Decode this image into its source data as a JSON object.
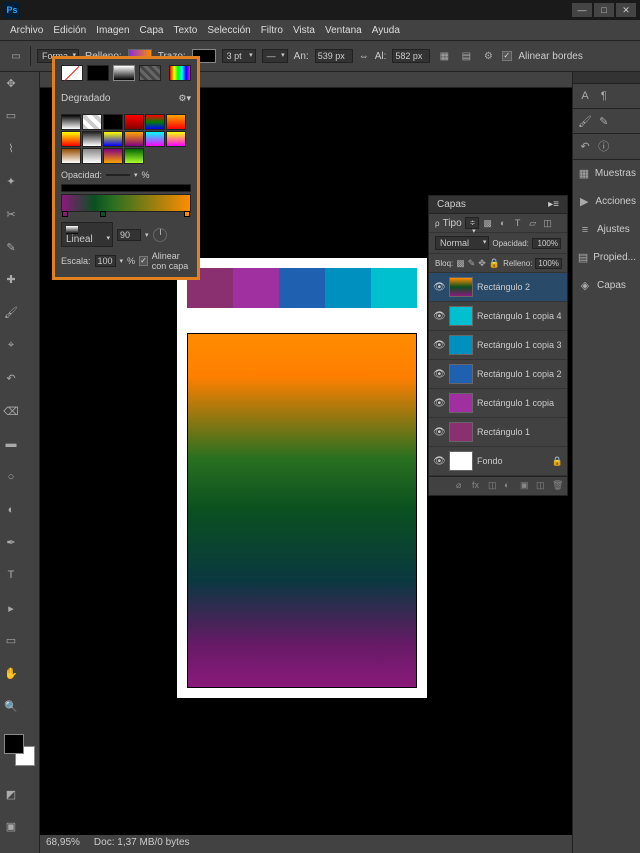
{
  "titlebar": {
    "min": "—",
    "max": "□",
    "close": "✕"
  },
  "menu": [
    "Archivo",
    "Edición",
    "Imagen",
    "Capa",
    "Texto",
    "Selección",
    "Filtro",
    "Vista",
    "Ventana",
    "Ayuda"
  ],
  "options": {
    "forma": "Forma",
    "relleno": "Relleno:",
    "trazo": "Trazo:",
    "stroke_pt": "3 pt",
    "an_lbl": "An:",
    "an": "539 px",
    "al_lbl": "Al:",
    "al": "582 px",
    "align": "Alinear bordes"
  },
  "gradPanel": {
    "title": "Degradado",
    "opacidad": "Opacidad:",
    "opac_val": "",
    "pct": "%",
    "estilo": "Lineal",
    "ang": "90",
    "ang_deg": "°",
    "escala_lbl": "Escala:",
    "escala": "100",
    "alinear": "Alinear con capa"
  },
  "presets": [
    "linear-gradient(#000,#fff)",
    "repeating-linear-gradient(45deg,#ccc 0 4px,#fff 4px 8px)",
    "linear-gradient(#000,#000)",
    "linear-gradient(red,#800)",
    "linear-gradient(red,green,blue)",
    "linear-gradient(orange,red)",
    "linear-gradient(yellow,red)",
    "linear-gradient(#222,#fff)",
    "linear-gradient(yellow,blue)",
    "linear-gradient(orange,purple)",
    "linear-gradient(cyan,magenta)",
    "linear-gradient(#ff0,#f0f)",
    "linear-gradient(#964B00,#fff)",
    "linear-gradient(#888,#fff)",
    "linear-gradient(#800080,#ffa500)",
    "linear-gradient(#006400,#adff2f)"
  ],
  "palette": [
    "#8a3070",
    "#a030a0",
    "#2060b0",
    "#0090c0",
    "#00c0d0"
  ],
  "layersPanel": {
    "tab": "Capas",
    "tipo": "Tipo",
    "blend": "Normal",
    "opac_lbl": "Opacidad:",
    "opac": "100%",
    "bloq": "Bloq:",
    "relleno_lbl": "Relleno:",
    "relleno": "100%",
    "layers": [
      {
        "name": "Rectángulo 2",
        "thumb": "linear-gradient(#ff8c00,#0a5020,#8a1a7a)",
        "sel": true
      },
      {
        "name": "Rectángulo 1 copia 4",
        "thumb": "#00c0d0"
      },
      {
        "name": "Rectángulo 1 copia 3",
        "thumb": "#0090c0"
      },
      {
        "name": "Rectángulo 1 copia 2",
        "thumb": "#2060b0"
      },
      {
        "name": "Rectángulo 1 copia",
        "thumb": "#a030a0"
      },
      {
        "name": "Rectángulo 1",
        "thumb": "#8a3070"
      },
      {
        "name": "Fondo",
        "thumb": "#fff",
        "locked": true
      }
    ]
  },
  "rightDock": [
    "Muestras",
    "Acciones",
    "Ajustes",
    "Propied...",
    "Capas"
  ],
  "status": {
    "zoom": "68,95%",
    "doc": "Doc: 1,37 MB/0 bytes"
  }
}
